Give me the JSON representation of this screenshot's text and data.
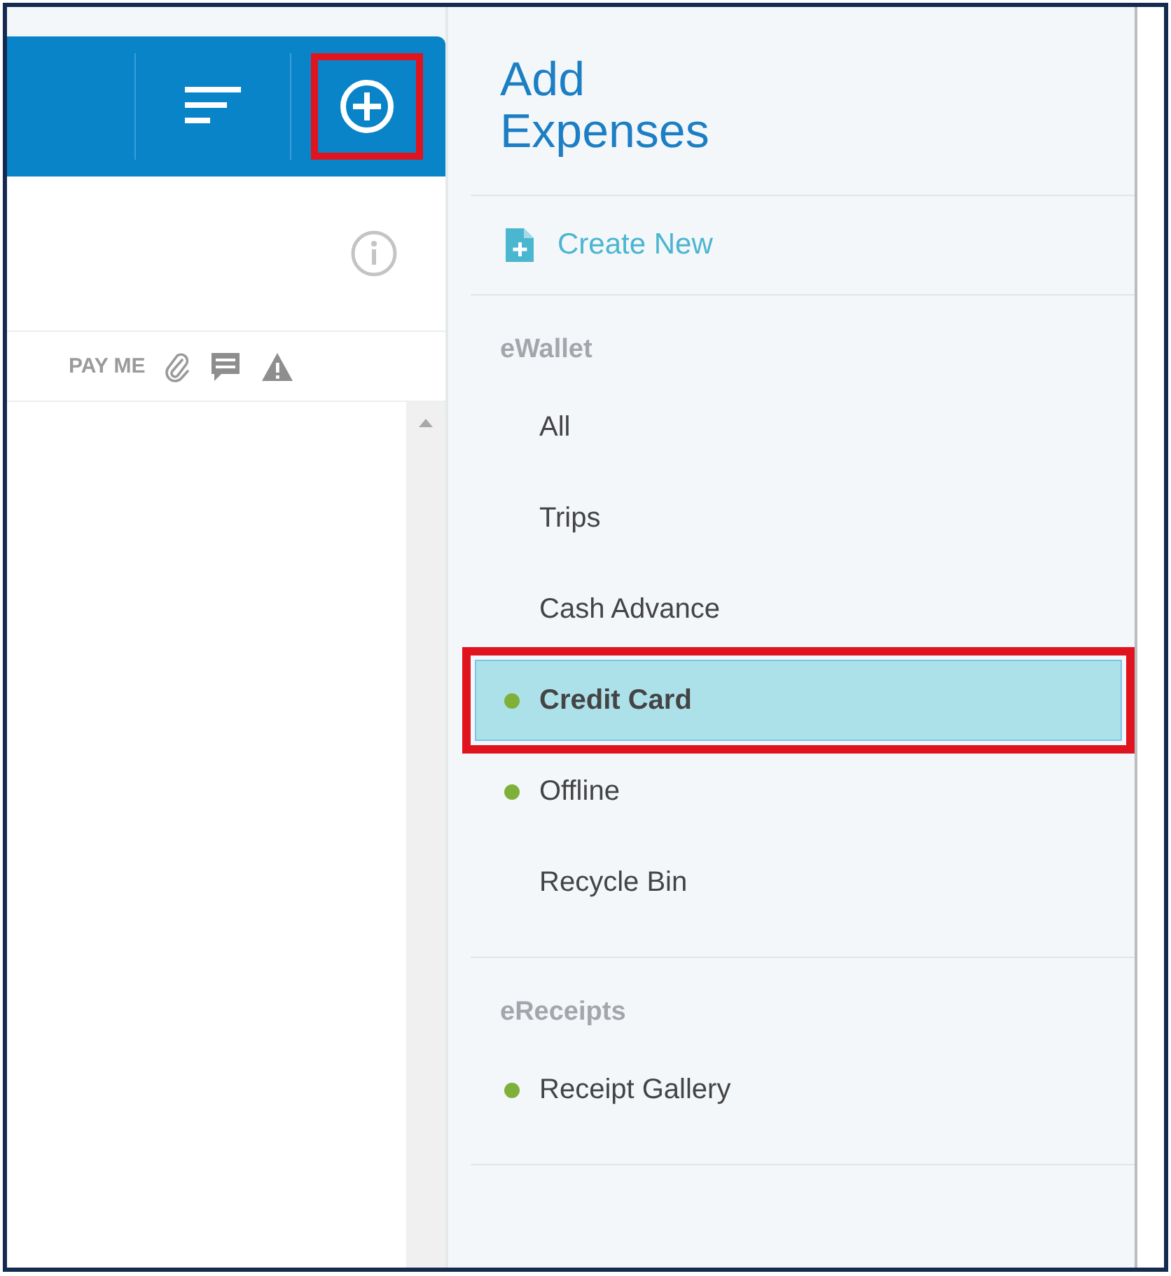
{
  "toolbar": {
    "add_button": {
      "highlighted": true
    }
  },
  "list_header": {
    "columns": [
      "PAY ME"
    ]
  },
  "panel": {
    "title": "Add Expenses",
    "create_new": "Create New",
    "sections": [
      {
        "heading": "eWallet",
        "items": [
          {
            "label": "All",
            "dot": false,
            "selected": false,
            "highlighted": false
          },
          {
            "label": "Trips",
            "dot": false,
            "selected": false,
            "highlighted": false
          },
          {
            "label": "Cash Advance",
            "dot": false,
            "selected": false,
            "highlighted": false
          },
          {
            "label": "Credit Card",
            "dot": true,
            "selected": true,
            "highlighted": true
          },
          {
            "label": "Offline",
            "dot": true,
            "selected": false,
            "highlighted": false
          },
          {
            "label": "Recycle Bin",
            "dot": false,
            "selected": false,
            "highlighted": false
          }
        ]
      },
      {
        "heading": "eReceipts",
        "items": [
          {
            "label": "Receipt Gallery",
            "dot": true,
            "selected": false,
            "highlighted": false
          }
        ]
      }
    ]
  }
}
